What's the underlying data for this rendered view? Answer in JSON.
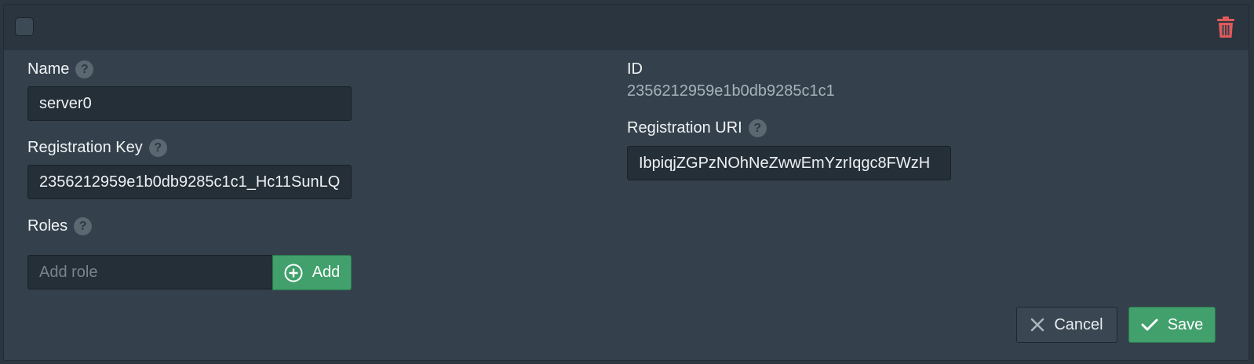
{
  "header": {
    "checkbox_checked": false,
    "delete_icon": "trash-icon",
    "delete_icon_color": "#e05a5a"
  },
  "fields": {
    "name": {
      "label": "Name",
      "value": "server0"
    },
    "registration_key": {
      "label": "Registration Key",
      "value": "2356212959e1b0db9285c1c1_Hc11SunLQ"
    },
    "roles": {
      "label": "Roles",
      "placeholder": "Add role",
      "add_label": "Add"
    },
    "id": {
      "label": "ID",
      "value": "2356212959e1b0db9285c1c1"
    },
    "registration_uri": {
      "label": "Registration URI",
      "value": "IbpiqjZGPzNOhNeZwwEmYzrIqgc8FWzH"
    }
  },
  "help_glyph": "?",
  "actions": {
    "cancel_label": "Cancel",
    "save_label": "Save"
  },
  "colors": {
    "accent_green": "#41a06c",
    "panel_bg": "#34414c",
    "header_bg": "#2a353f"
  }
}
